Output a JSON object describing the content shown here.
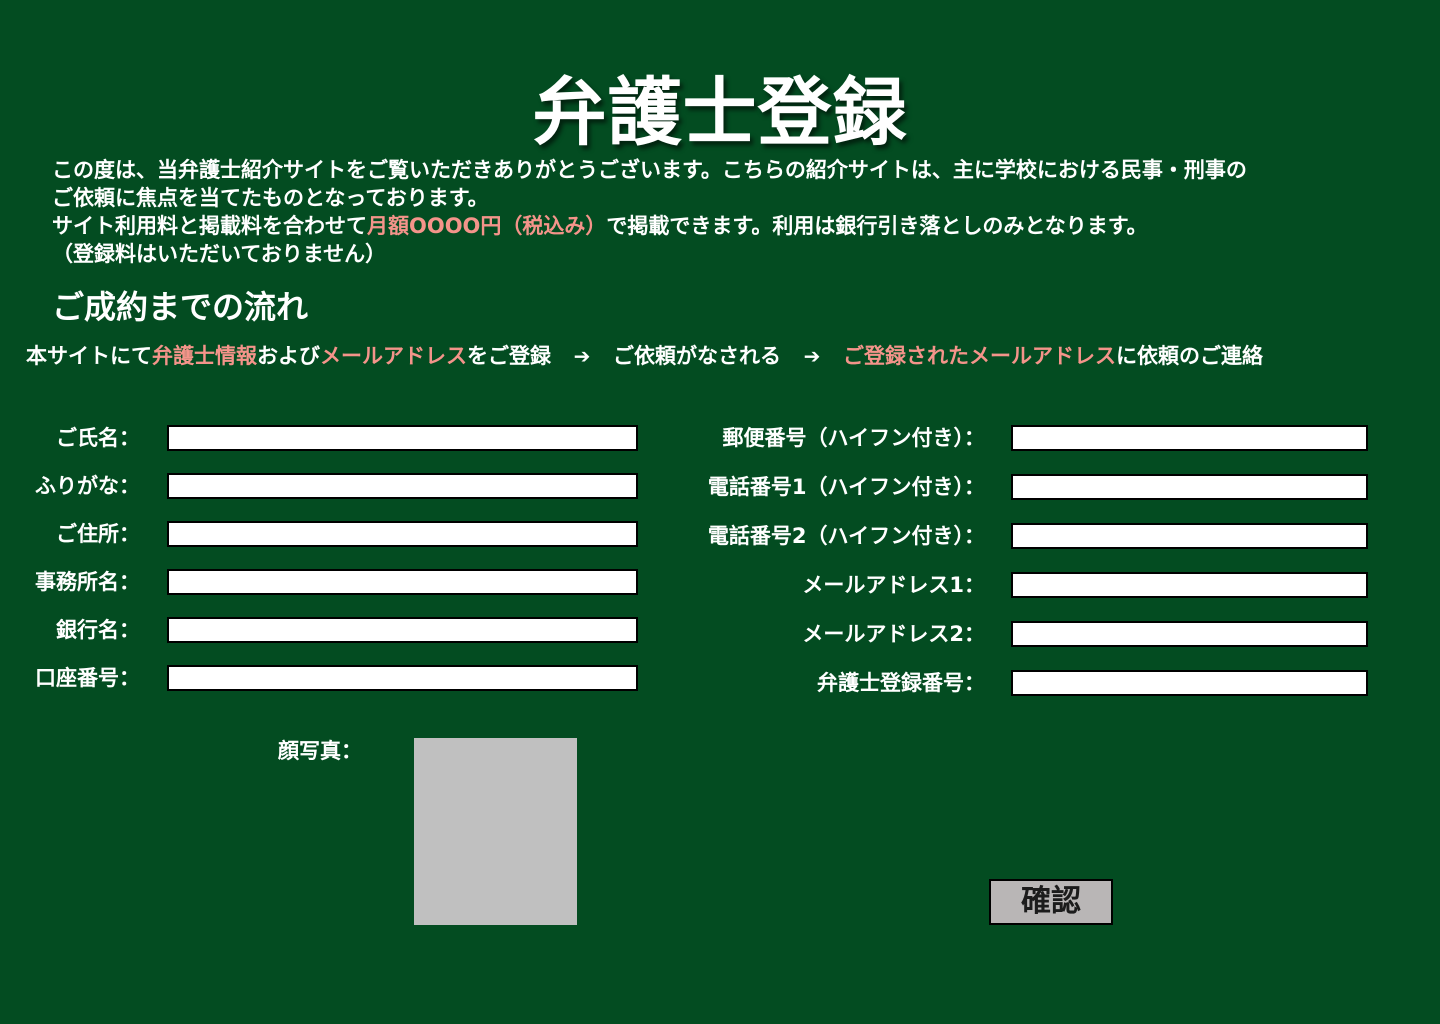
{
  "title": "弁護士登録",
  "intro": {
    "line1": "この度は、当弁護士紹介サイトをご覧いただきありがとうございます。こちらの紹介サイトは、主に学校における民事・刑事の",
    "line2": "ご依頼に焦点を当てたものとなっております。",
    "line3_before": "サイト利用料と掲載料を合わせて",
    "line3_highlight": "月額OOOO円（税込み）",
    "line3_after": "で掲載できます。利用は銀行引き落としのみとなります。",
    "line4": "（登録料はいただいておりません）"
  },
  "flow": {
    "heading": "ご成約までの流れ",
    "step1_a": "本サイトにて",
    "step1_b": "弁護士情報",
    "step1_c": "および",
    "step1_d": "メールアドレス",
    "step1_e": "をご登録",
    "arrow": "➔",
    "step2": "ご依頼がなされる",
    "step3_a": "ご登録されたメールアドレス",
    "step3_b": "に依頼のご連絡"
  },
  "form": {
    "left_fields": [
      {
        "label": "ご氏名：",
        "value": ""
      },
      {
        "label": "ふりがな：",
        "value": ""
      },
      {
        "label": "ご住所：",
        "value": ""
      },
      {
        "label": "事務所名：",
        "value": ""
      },
      {
        "label": "銀行名：",
        "value": ""
      },
      {
        "label": "口座番号：",
        "value": ""
      }
    ],
    "right_fields": [
      {
        "label": "郵便番号（ハイフン付き）：",
        "value": ""
      },
      {
        "label": "電話番号1（ハイフン付き）：",
        "value": ""
      },
      {
        "label": "電話番号2（ハイフン付き）：",
        "value": ""
      },
      {
        "label": "メールアドレス1：",
        "value": ""
      },
      {
        "label": "メールアドレス2：",
        "value": ""
      },
      {
        "label": "弁護士登録番号：",
        "value": ""
      }
    ],
    "photo_label": "顔写真：",
    "confirm_label": "確認"
  },
  "colors": {
    "background": "#034c21",
    "highlight": "#f4948a",
    "photo_placeholder": "#c0c0c0",
    "button_bg": "#b9b6b6"
  }
}
